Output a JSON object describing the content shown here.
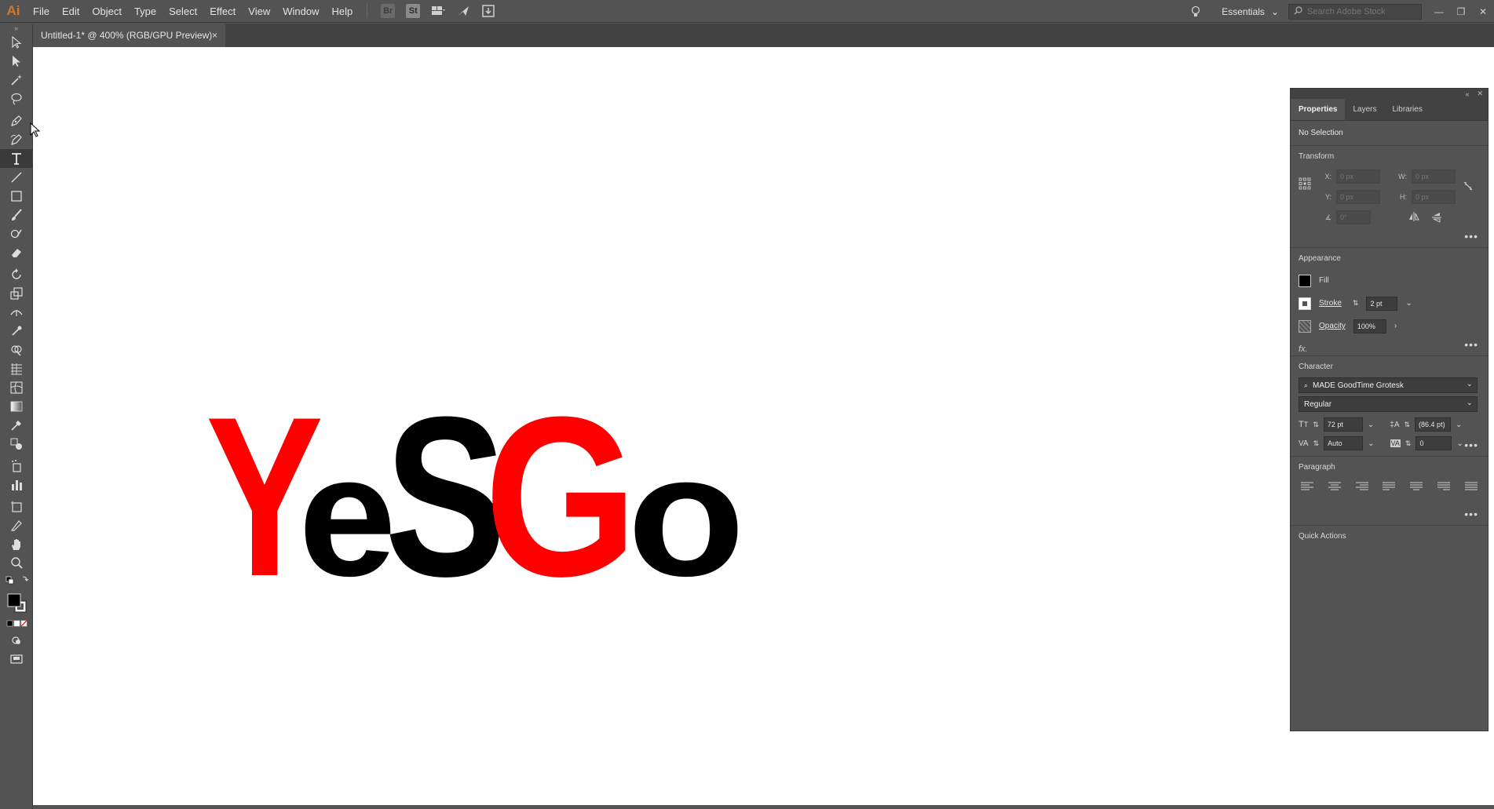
{
  "app": {
    "logo": "Ai",
    "menu": [
      "File",
      "Edit",
      "Object",
      "Type",
      "Select",
      "Effect",
      "View",
      "Window",
      "Help"
    ],
    "bridge_label": "Br",
    "stock_label": "St",
    "workspace": "Essentials",
    "search_placeholder": "Search Adobe Stock"
  },
  "document": {
    "tab_title": "Untitled-1* @ 400% (RGB/GPU Preview)",
    "close_glyph": "×"
  },
  "artwork": {
    "word": "YeSGo",
    "letters": [
      {
        "char": "Y",
        "color": "#ff0000"
      },
      {
        "char": "e",
        "color": "#000000"
      },
      {
        "char": "S",
        "color": "#000000"
      },
      {
        "char": "G",
        "color": "#ff0000"
      },
      {
        "char": "o",
        "color": "#000000"
      }
    ]
  },
  "panel": {
    "tabs": [
      "Properties",
      "Layers",
      "Libraries"
    ],
    "selection": "No Selection",
    "transform": {
      "title": "Transform",
      "x_label": "X:",
      "x_value": "0 px",
      "y_label": "Y:",
      "y_value": "0 px",
      "w_label": "W:",
      "w_value": "0 px",
      "h_label": "H:",
      "h_value": "0 px",
      "angle_value": "0°"
    },
    "appearance": {
      "title": "Appearance",
      "fill_label": "Fill",
      "fill_color": "#000000",
      "stroke_label": "Stroke",
      "stroke_value": "2 pt",
      "opacity_label": "Opacity",
      "opacity_value": "100%",
      "fx_label": "fx."
    },
    "character": {
      "title": "Character",
      "font_family": "MADE GoodTime Grotesk",
      "font_style": "Regular",
      "font_size": "72 pt",
      "leading": "(86.4 pt)",
      "kerning": "Auto",
      "tracking": "0"
    },
    "paragraph": {
      "title": "Paragraph"
    },
    "quick_actions": {
      "title": "Quick Actions"
    }
  }
}
